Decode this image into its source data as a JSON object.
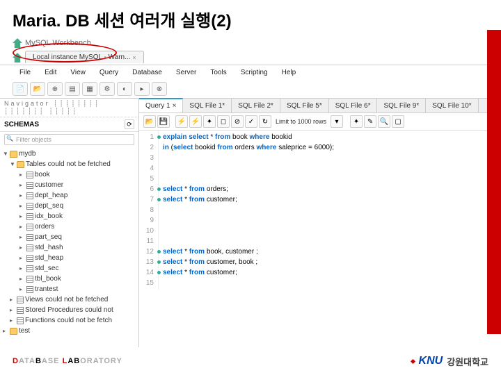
{
  "title": "Maria. DB 세션 여러개 실행(2)",
  "app": {
    "name": "MySQL Workbench"
  },
  "conn_tab": {
    "label": "Local instance MySQL - Warn...",
    "close": "×"
  },
  "menu": [
    "File",
    "Edit",
    "View",
    "Query",
    "Database",
    "Server",
    "Tools",
    "Scripting",
    "Help"
  ],
  "nav": {
    "header": "Navigator ┊┊┊┊┊┊┊┊  ┊┊┊┊┊┊┊  ┊┊┊┊┊",
    "schemas": "SCHEMAS",
    "filter": "Filter objects",
    "db": "mydb",
    "tables_err": "Tables could not be fetched",
    "tables": [
      "book",
      "customer",
      "dept_heap",
      "dept_seq",
      "idx_book",
      "orders",
      "part_seq",
      "std_hash",
      "std_heap",
      "std_sec",
      "tbl_book",
      "trantest"
    ],
    "views_err": "Views could not be fetched",
    "sp_err": "Stored Procedures could not",
    "fn_err": "Functions could not be fetch",
    "test_db": "test"
  },
  "editor": {
    "tabs": [
      "Query 1",
      "SQL File 1*",
      "SQL File 2*",
      "SQL File 5*",
      "SQL File 6*",
      "SQL File 9*",
      "SQL File 10*"
    ],
    "limit": "Limit to 1000 rows",
    "lines": 15,
    "code": {
      "l1": {
        "kw": "explain select",
        "rest": " * ",
        "kw2": "from",
        "rest2": " book ",
        "kw3": "where",
        "rest3": " bookid"
      },
      "l2": {
        "kw": "in",
        "rest": " (",
        "kw2": "select",
        "rest2": " bookid ",
        "kw3": "from",
        "rest3": " orders ",
        "kw4": "where",
        "rest4": " saleprice = 6000);"
      },
      "l6": {
        "kw": "select",
        "rest": " * ",
        "kw2": "from",
        "rest2": " orders;"
      },
      "l7": {
        "kw": "select",
        "rest": " * ",
        "kw2": "from",
        "rest2": " customer;"
      },
      "l12": {
        "kw": "select",
        "rest": " * ",
        "kw2": "from",
        "rest2": " book, customer ;"
      },
      "l13": {
        "kw": "select",
        "rest": " * ",
        "kw2": "from",
        "rest2": " customer, book ;"
      },
      "l14": {
        "kw": "select",
        "rest": " * ",
        "kw2": "from",
        "rest2": " customer;"
      }
    }
  },
  "footer": {
    "lab": {
      "d": "D",
      "ata": "ATA",
      "b": "B",
      "ase": "ASE",
      "sp": " ",
      "l": "L",
      "a": "A",
      "b2": "B",
      "oratory": "ORATORY"
    },
    "univ": {
      "knu": "KNU",
      "name": "강원대학교"
    }
  }
}
